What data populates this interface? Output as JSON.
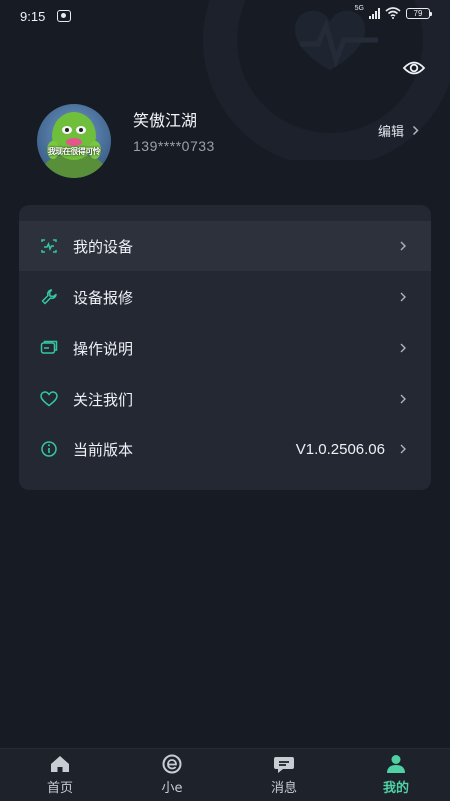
{
  "status_bar": {
    "time": "9:15",
    "network": "5G",
    "battery": "79"
  },
  "profile": {
    "name": "笑傲江湖",
    "phone": "139****0733",
    "avatar_caption": "我现在很得可怜",
    "edit_label": "编辑"
  },
  "menu": {
    "items": [
      {
        "label": "我的设备",
        "icon": "device-icon"
      },
      {
        "label": "设备报修",
        "icon": "wrench-icon"
      },
      {
        "label": "操作说明",
        "icon": "manual-icon"
      },
      {
        "label": "关注我们",
        "icon": "heart-icon"
      },
      {
        "label": "当前版本",
        "icon": "info-icon",
        "value": "V1.0.2506.06"
      }
    ]
  },
  "tabs": [
    {
      "label": "首页",
      "icon": "home-icon"
    },
    {
      "label": "小e",
      "icon": "e-icon"
    },
    {
      "label": "消息",
      "icon": "message-icon"
    },
    {
      "label": "我的",
      "icon": "profile-icon",
      "active": true
    }
  ],
  "colors": {
    "background": "#171b24",
    "card": "#232833",
    "accent": "#4fd1a3",
    "icon_teal": "#34c6a4"
  }
}
